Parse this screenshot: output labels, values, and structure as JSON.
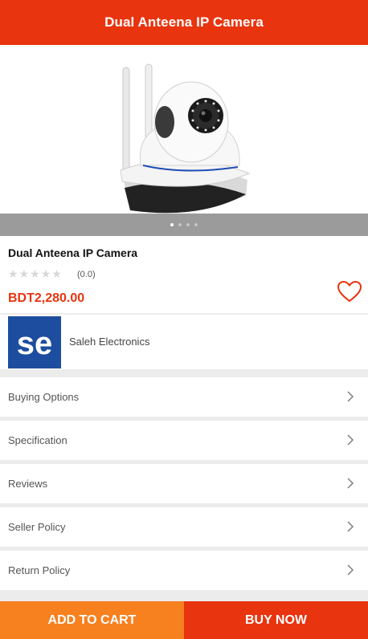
{
  "header": {
    "title": "Dual Anteena IP Camera"
  },
  "carousel": {
    "slides": 4,
    "active_index": 0
  },
  "product": {
    "title": "Dual Anteena IP Camera",
    "rating_text": "(0.0)",
    "rating_value": 0.0,
    "rating_max": 5,
    "price": "BDT2,280.00",
    "wishlist_icon": "heart-outline-icon"
  },
  "seller": {
    "logo_text": "se",
    "name": "Saleh Electronics"
  },
  "menu": [
    {
      "label": "Buying Options",
      "icon": "chevron-right-icon"
    },
    {
      "label": "Specification",
      "icon": "chevron-right-icon"
    },
    {
      "label": "Reviews",
      "icon": "chevron-right-icon"
    },
    {
      "label": "Seller Policy",
      "icon": "chevron-right-icon"
    },
    {
      "label": "Return Policy",
      "icon": "chevron-right-icon"
    }
  ],
  "actions": {
    "add_to_cart": "ADD TO CART",
    "buy_now": "BUY NOW"
  },
  "colors": {
    "primary": "#e8340f",
    "secondary": "#f7801f",
    "background": "#ececec"
  }
}
